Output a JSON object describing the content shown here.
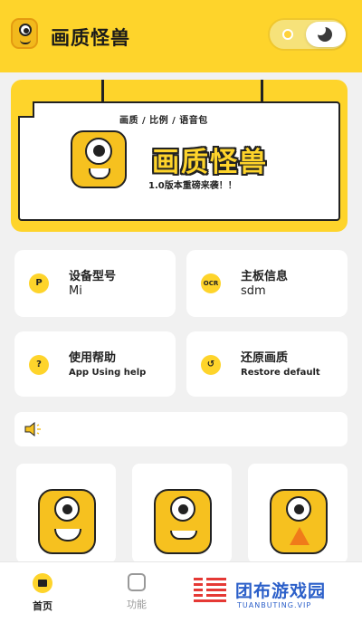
{
  "header": {
    "title": "画质怪兽",
    "logo_icon": "monster-logo-icon",
    "theme_toggle": {
      "left_icon": "sun-icon",
      "right_icon": "moon-icon"
    }
  },
  "banner": {
    "tags": "画质 / 比例 / 语音包",
    "big_title": "画质怪兽",
    "version_text": "1.0版本重磅来袭！！",
    "mascot_icon": "monster-mascot-icon"
  },
  "cards": [
    {
      "title": "设备型号",
      "subtitle": "Mi",
      "icon": "p-icon"
    },
    {
      "title": "主板信息",
      "subtitle": "sdm",
      "icon": "ocr-icon"
    },
    {
      "title": "使用帮助",
      "subtitle": "App Using help",
      "icon": "help-icon"
    },
    {
      "title": "还原画质",
      "subtitle": "Restore default",
      "icon": "restore-icon"
    }
  ],
  "notice": {
    "icon": "speaker-icon"
  },
  "mode_cards": [
    {
      "icon": "monster-happy-icon"
    },
    {
      "icon": "monster-grin-icon"
    },
    {
      "icon": "monster-warning-icon"
    }
  ],
  "bottom_nav": {
    "items": [
      {
        "label": "首页",
        "icon": "home-icon",
        "active": true
      },
      {
        "label": "功能",
        "icon": "function-icon",
        "active": false
      }
    ]
  },
  "watermark": {
    "text": "团布游戏园",
    "url": "TUANBUTING.VIP"
  },
  "colors": {
    "brand_yellow": "#fed42b",
    "background": "#f1f1f1",
    "watermark_blue": "#2b5fc9"
  }
}
